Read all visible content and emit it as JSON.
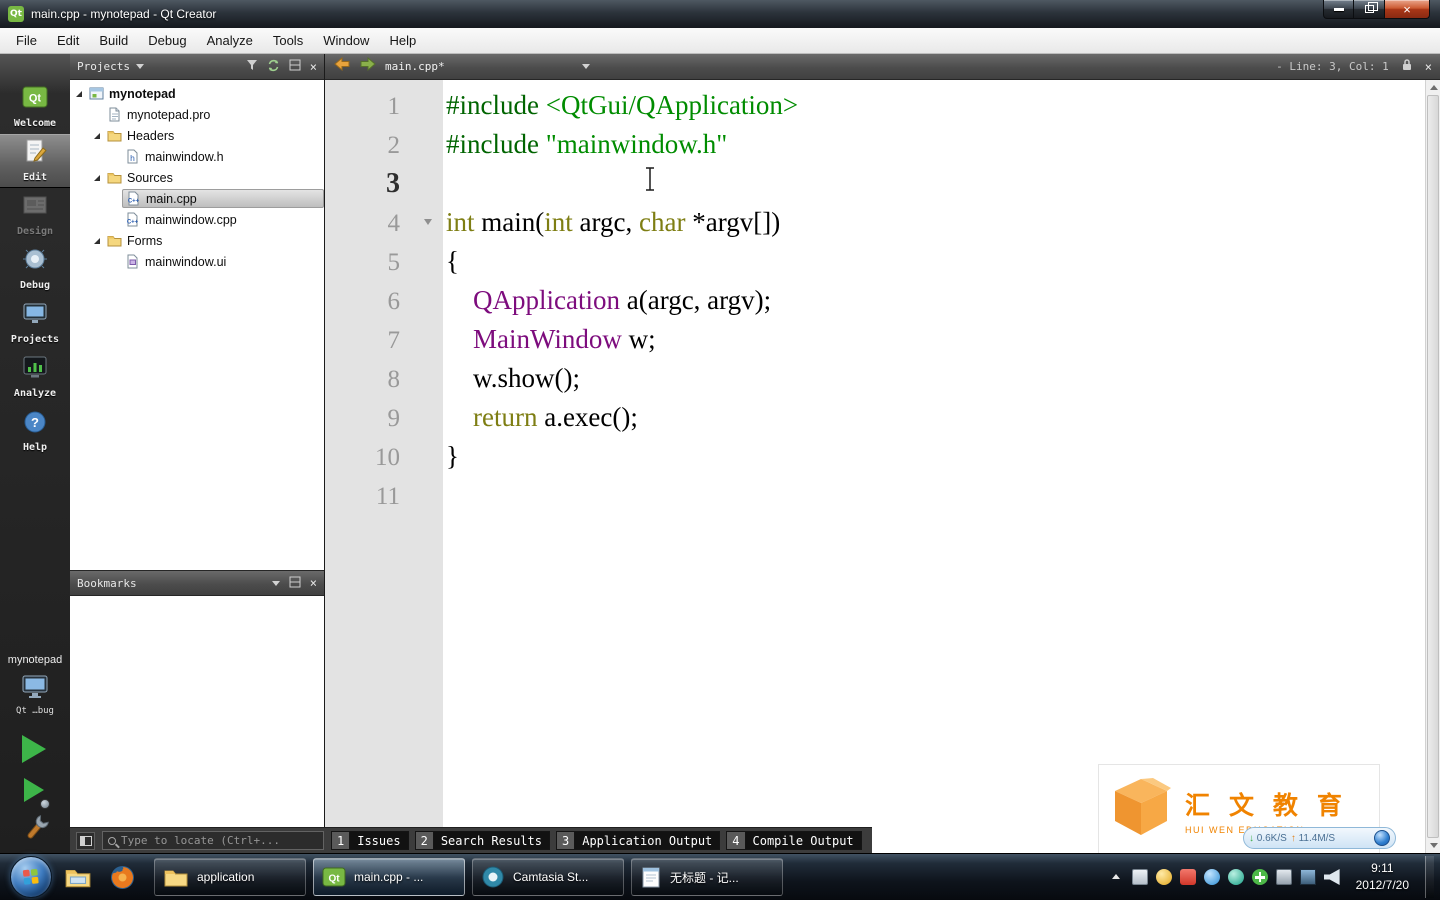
{
  "window": {
    "title": "main.cpp - mynotepad - Qt Creator"
  },
  "menu": {
    "items": [
      "File",
      "Edit",
      "Build",
      "Debug",
      "Analyze",
      "Tools",
      "Window",
      "Help"
    ]
  },
  "modebar": {
    "items": [
      {
        "label": "Welcome",
        "icon": "welcome",
        "state": "normal"
      },
      {
        "label": "Edit",
        "icon": "edit",
        "state": "active"
      },
      {
        "label": "Design",
        "icon": "design",
        "state": "disabled"
      },
      {
        "label": "Debug",
        "icon": "debug",
        "state": "normal"
      },
      {
        "label": "Projects",
        "icon": "projects",
        "state": "normal"
      },
      {
        "label": "Analyze",
        "icon": "analyze",
        "state": "normal"
      },
      {
        "label": "Help",
        "icon": "help",
        "state": "normal"
      }
    ],
    "project_label": "mynotepad",
    "kit_text": "Qt …bug"
  },
  "projects_pane": {
    "title": "Projects",
    "tree": [
      {
        "label": "mynotepad",
        "level": 0,
        "icon": "project",
        "expanded": true,
        "bold": true
      },
      {
        "label": "mynotepad.pro",
        "level": 1,
        "icon": "profile"
      },
      {
        "label": "Headers",
        "level": 1,
        "icon": "folder-h",
        "expanded": true
      },
      {
        "label": "mainwindow.h",
        "level": 2,
        "icon": "file-h"
      },
      {
        "label": "Sources",
        "level": 1,
        "icon": "folder-src",
        "expanded": true
      },
      {
        "label": "main.cpp",
        "level": 2,
        "icon": "file-cpp",
        "selected": true
      },
      {
        "label": "mainwindow.cpp",
        "level": 2,
        "icon": "file-cpp"
      },
      {
        "label": "Forms",
        "level": 1,
        "icon": "folder-forms",
        "expanded": true
      },
      {
        "label": "mainwindow.ui",
        "level": 2,
        "icon": "file-ui"
      }
    ]
  },
  "bookmarks_pane": {
    "title": "Bookmarks"
  },
  "editor": {
    "file_tab": "main.cpp*",
    "line_col": "- Line: 3, Col: 1",
    "lines": [
      {
        "n": "1",
        "tokens": [
          {
            "c": "pp",
            "t": "#include "
          },
          {
            "c": "str",
            "t": "<QtGui/QApplication>"
          }
        ]
      },
      {
        "n": "2",
        "tokens": [
          {
            "c": "pp",
            "t": "#include "
          },
          {
            "c": "str",
            "t": "\"mainwindow.h\""
          }
        ]
      },
      {
        "n": "3",
        "tokens": [],
        "current": true
      },
      {
        "n": "4",
        "tokens": [
          {
            "c": "kw",
            "t": "int"
          },
          {
            "c": "pl",
            "t": " main("
          },
          {
            "c": "kw",
            "t": "int"
          },
          {
            "c": "pl",
            "t": " argc, "
          },
          {
            "c": "kw",
            "t": "char"
          },
          {
            "c": "pl",
            "t": " *argv[])"
          }
        ],
        "fold": true
      },
      {
        "n": "5",
        "tokens": [
          {
            "c": "pl",
            "t": "{"
          }
        ]
      },
      {
        "n": "6",
        "tokens": [
          {
            "c": "pl",
            "t": "    "
          },
          {
            "c": "type",
            "t": "QApplication"
          },
          {
            "c": "pl",
            "t": " a(argc, argv);"
          }
        ]
      },
      {
        "n": "7",
        "tokens": [
          {
            "c": "pl",
            "t": "    "
          },
          {
            "c": "type",
            "t": "MainWindow"
          },
          {
            "c": "pl",
            "t": " w;"
          }
        ]
      },
      {
        "n": "8",
        "tokens": [
          {
            "c": "pl",
            "t": "    w.show();"
          }
        ]
      },
      {
        "n": "9",
        "tokens": [
          {
            "c": "pl",
            "t": "    "
          },
          {
            "c": "kw",
            "t": "return"
          },
          {
            "c": "pl",
            "t": " a.exec();"
          }
        ]
      },
      {
        "n": "10",
        "tokens": [
          {
            "c": "pl",
            "t": "}"
          }
        ]
      },
      {
        "n": "11",
        "tokens": []
      }
    ]
  },
  "locator": {
    "placeholder": "Type to locate (Ctrl+..."
  },
  "output_panes": [
    {
      "key": "1",
      "label": "Issues"
    },
    {
      "key": "2",
      "label": "Search Results"
    },
    {
      "key": "3",
      "label": "Application Output"
    },
    {
      "key": "4",
      "label": "Compile Output"
    }
  ],
  "taskbar": {
    "buttons": [
      {
        "label": "application",
        "icon": "folder",
        "active": false
      },
      {
        "label": "main.cpp - ...",
        "icon": "qt",
        "active": true
      },
      {
        "label": "Camtasia St...",
        "icon": "camtasia",
        "active": false
      },
      {
        "label": "无标题 - 记...",
        "icon": "notepad",
        "active": false
      }
    ],
    "tray_icons": [
      "expand-arrow",
      "keyboard",
      "safe",
      "input-method",
      "qq",
      "swirl",
      "plus",
      "printer",
      "monitor",
      "volume"
    ],
    "time": "9:11",
    "date": "2012/7/20"
  },
  "watermark": {
    "cn": "汇 文 教 育",
    "en": "HUI WEN EDUCATION"
  },
  "netmeter": {
    "down": "0.6K/S",
    "up": "11.4M/S"
  }
}
